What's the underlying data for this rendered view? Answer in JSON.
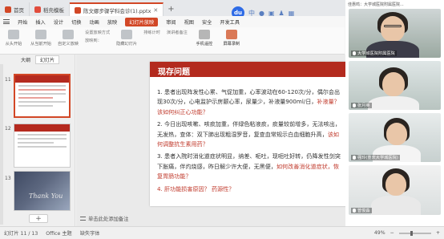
{
  "tabs": {
    "home": "首页",
    "template": "稻壳模板",
    "document": "陈文娜步骤学科会诊(1).pptx"
  },
  "menu": {
    "items": [
      "开始",
      "插入",
      "设计",
      "切换",
      "动画",
      "放映",
      "审阅",
      "视图",
      "安全",
      "开发工具"
    ],
    "active": "幻灯片放映"
  },
  "toolbar": {
    "from_start": "从头开始",
    "from_current": "从当前开始",
    "custom": "自定义放映",
    "set_show": "设置放映方式",
    "hide": "隐藏幻灯片",
    "rehearse": "排练计时",
    "speaker_notes": "演讲者备注",
    "show_on": "放映到：",
    "remote": "手机遥控",
    "screen_record": "屏幕录制"
  },
  "pane": {
    "tab_outline": "大纲",
    "tab_slides": "幻灯片",
    "slide_numbers": [
      "11",
      "12",
      "13"
    ],
    "thumb_text_13": "Thank You"
  },
  "slide": {
    "title": "现存问题",
    "items": [
      {
        "text": "1. 患者出现阵发性心累、气促加重，心率波动在60-120次/分，偶尔会出现30次/分，心电监护示房颤心率，尿量少，补液量900ml/日，",
        "question": "补液量？ 该如何纠正心功能？"
      },
      {
        "text": "2. 今日出现咳嗽、咳痰加重，伴绿色粘液痰，痰量较前增多，无法咳出，无发热，查体：双下肺出现粗湿罗音，复查血常规示白血细胞升高，",
        "question": "该如何调整抗生素用药？"
      },
      {
        "text": "3. 患者入院时消化道症状明显，纳差、呃吐，现呃吐好转，仍降发性剑突下胀痛，伴灼烧感，昨日解少许大便，无黑便，",
        "question": "如何改善消化道症状，恢复胃肠功能？"
      },
      {
        "text": "",
        "question": "4. 肝功能损害原因？ 药源性？"
      }
    ]
  },
  "notes_placeholder": "单击此处添加备注",
  "status": {
    "slide_info": "幻灯片 11 / 13",
    "theme": "Office 主题",
    "font_missing": "缺失字体",
    "zoom": "49%"
  },
  "video": {
    "header": "佳惠鸣：大学城医院附属医院...",
    "participants": [
      {
        "name": "大学城医院附属医院"
      },
      {
        "name": "张月英"
      },
      {
        "name": "强玲(重庆大学城医院)"
      },
      {
        "name": "曾俊淼"
      }
    ]
  },
  "colors": {
    "accent": "#d24726",
    "slide_title_bg": "#b32a1e",
    "question_text": "#c0392b"
  }
}
